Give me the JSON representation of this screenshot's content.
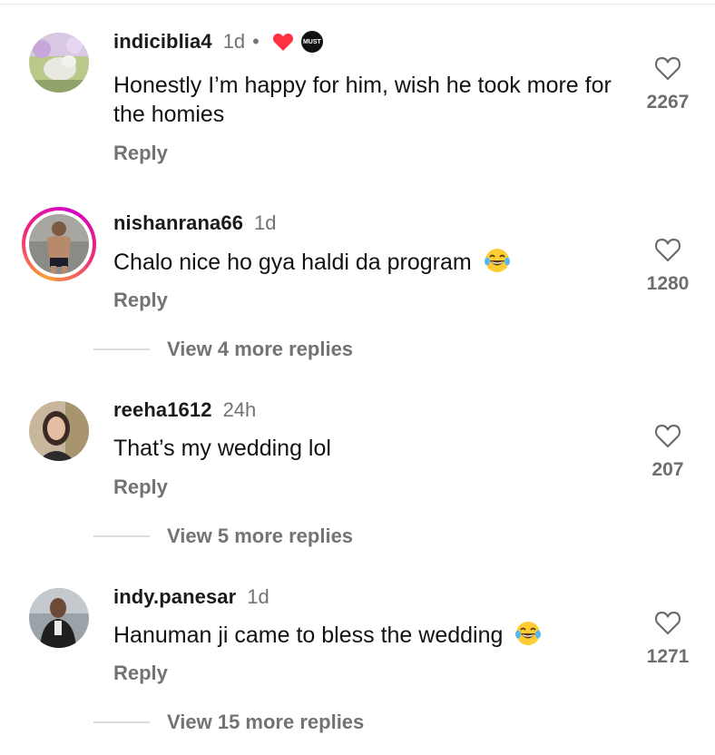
{
  "comments": [
    {
      "username": "indiciblia4",
      "time": "1d",
      "separator": "•",
      "text": "Honestly I’m happy for him, wish he took more for the homies",
      "reply_label": "Reply",
      "likes": "2267",
      "badges": [
        "heart-icon",
        "creator-avatar-badge"
      ],
      "creator_badge_text": "MUST"
    },
    {
      "username": "nishanrana66",
      "time": "1d",
      "text": "Chalo nice ho gya haldi da program",
      "emoji": "laughing-tears-emoji",
      "reply_label": "Reply",
      "likes": "1280",
      "view_replies": "View 4 more replies",
      "story_ring": true
    },
    {
      "username": "reeha1612",
      "time": "24h",
      "text": "That’s my wedding lol",
      "reply_label": "Reply",
      "likes": "207",
      "view_replies": "View 5 more replies"
    },
    {
      "username": "indy.panesar",
      "time": "1d",
      "text": "Hanuman ji came to bless the wedding",
      "emoji": "laughing-tears-emoji",
      "reply_label": "Reply",
      "likes": "1271",
      "view_replies": "View 15 more replies"
    }
  ],
  "colors": {
    "heart_badge": "#ff3040",
    "muted_text": "#737373",
    "story_ring": [
      "#f9a13a",
      "#ee2a7b",
      "#d300c5"
    ]
  }
}
